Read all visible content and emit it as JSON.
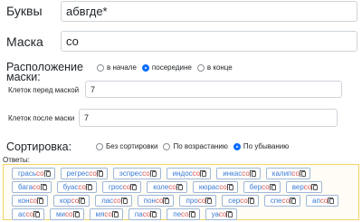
{
  "letters": {
    "label": "Буквы",
    "value": "абвгде*"
  },
  "mask": {
    "label": "Маска",
    "value": "со"
  },
  "placement": {
    "label": "Расположение маски:",
    "options": [
      "в начале",
      "посередине",
      "в конце"
    ],
    "selected": 1
  },
  "before": {
    "label": "Клеток перед маской",
    "value": "7"
  },
  "after": {
    "label": "Клеток после маски",
    "value": "7"
  },
  "sort": {
    "label": "Сортировка:",
    "options": [
      "Без сортировки",
      "По возрастанию",
      "По убыванию"
    ],
    "selected": 2
  },
  "answers": {
    "label": "Ответы:",
    "items": [
      {
        "stem": "грась",
        "mask": "со"
      },
      {
        "stem": "регрес",
        "mask": "со"
      },
      {
        "stem": "эспрес",
        "mask": "со"
      },
      {
        "stem": "индос",
        "mask": "со"
      },
      {
        "stem": "инкас",
        "mask": "со"
      },
      {
        "stem": "калип",
        "mask": "со"
      },
      {
        "stem": "бага",
        "mask": "со"
      },
      {
        "stem": "буас",
        "mask": "со"
      },
      {
        "stem": "грос",
        "mask": "со"
      },
      {
        "stem": "коле",
        "mask": "со"
      },
      {
        "stem": "кюрас",
        "mask": "со"
      },
      {
        "stem": "бер",
        "mask": "со"
      },
      {
        "stem": "вер",
        "mask": "со"
      },
      {
        "stem": "кон",
        "mask": "со"
      },
      {
        "stem": "кор",
        "mask": "со"
      },
      {
        "stem": "лас",
        "mask": "со"
      },
      {
        "stem": "пон",
        "mask": "со"
      },
      {
        "stem": "про",
        "mask": "со"
      },
      {
        "stem": "сер",
        "mask": "со"
      },
      {
        "stem": "спе",
        "mask": "со"
      },
      {
        "stem": "ап",
        "mask": "со"
      },
      {
        "stem": "ас",
        "mask": "со"
      },
      {
        "stem": "ми",
        "mask": "со"
      },
      {
        "stem": "мя",
        "mask": "со"
      },
      {
        "stem": "па",
        "mask": "со"
      },
      {
        "stem": "пе",
        "mask": "со"
      },
      {
        "stem": "уа",
        "mask": "со"
      }
    ]
  }
}
